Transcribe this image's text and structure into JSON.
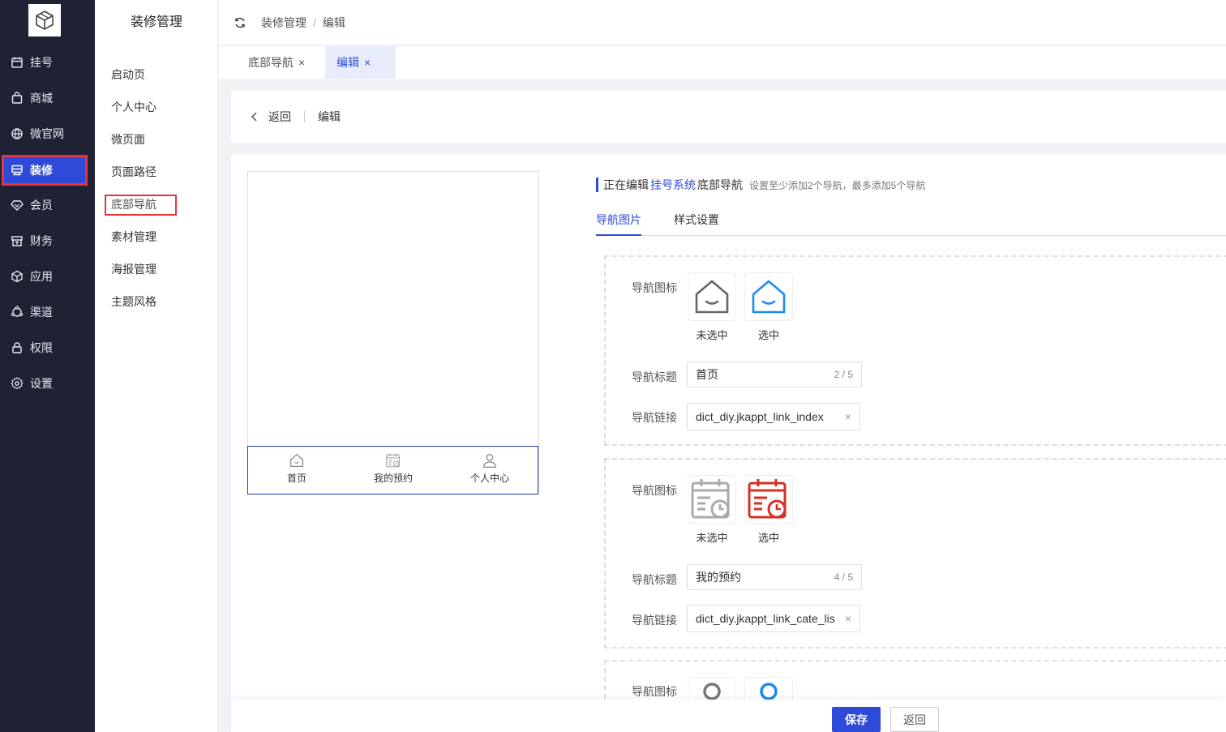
{
  "sidebar": {
    "items": [
      {
        "label": "挂号",
        "icon": "calendar-icon"
      },
      {
        "label": "商城",
        "icon": "shopping-bag-icon"
      },
      {
        "label": "微官网",
        "icon": "globe-icon"
      },
      {
        "label": "装修",
        "icon": "decoration-icon",
        "active": true
      },
      {
        "label": "会员",
        "icon": "diamond-icon"
      },
      {
        "label": "财务",
        "icon": "finance-icon"
      },
      {
        "label": "应用",
        "icon": "cube-icon"
      },
      {
        "label": "渠道",
        "icon": "channel-icon"
      },
      {
        "label": "权限",
        "icon": "lock-icon"
      },
      {
        "label": "设置",
        "icon": "gear-icon"
      }
    ]
  },
  "subnav": {
    "title": "装修管理",
    "items": [
      "启动页",
      "个人中心",
      "微页面",
      "页面路径",
      "底部导航",
      "素材管理",
      "海报管理",
      "主题风格"
    ]
  },
  "header": {
    "breadcrumb": [
      "装修管理",
      "编辑"
    ],
    "sep": "/"
  },
  "tabs": [
    {
      "label": "底部导航",
      "close": "×"
    },
    {
      "label": "编辑",
      "close": "×",
      "active": true
    }
  ],
  "backbar": {
    "back_label": "返回",
    "current": "编辑"
  },
  "preview": {
    "nav": [
      {
        "label": "首页"
      },
      {
        "label": "我的预约"
      },
      {
        "label": "个人中心"
      }
    ]
  },
  "editor": {
    "head_prefix": "正在编辑",
    "head_link": "挂号系统",
    "head_suffix": "底部导航",
    "hint": "设置至少添加2个导航，最多添加5个导航",
    "tabs": [
      "导航图片",
      "样式设置"
    ],
    "labels": {
      "icon": "导航图标",
      "title": "导航标题",
      "link": "导航链接",
      "unselected": "未选中",
      "selected": "选中"
    },
    "items": [
      {
        "title": "首页",
        "count": "2 / 5",
        "link": "dict_diy.jkappt_link_index",
        "clear": "×"
      },
      {
        "title": "我的预约",
        "count": "4 / 5",
        "link": "dict_diy.jkappt_link_cate_lis",
        "clear": "×"
      }
    ]
  },
  "footer": {
    "save_label": "保存",
    "back_label": "返回"
  },
  "colors": {
    "primary": "#2d4bd8",
    "sidebar_bg": "#1f2234",
    "highlight": "#e5353d",
    "selected_red": "#d63026",
    "selected_blue": "#1a8cf0"
  }
}
